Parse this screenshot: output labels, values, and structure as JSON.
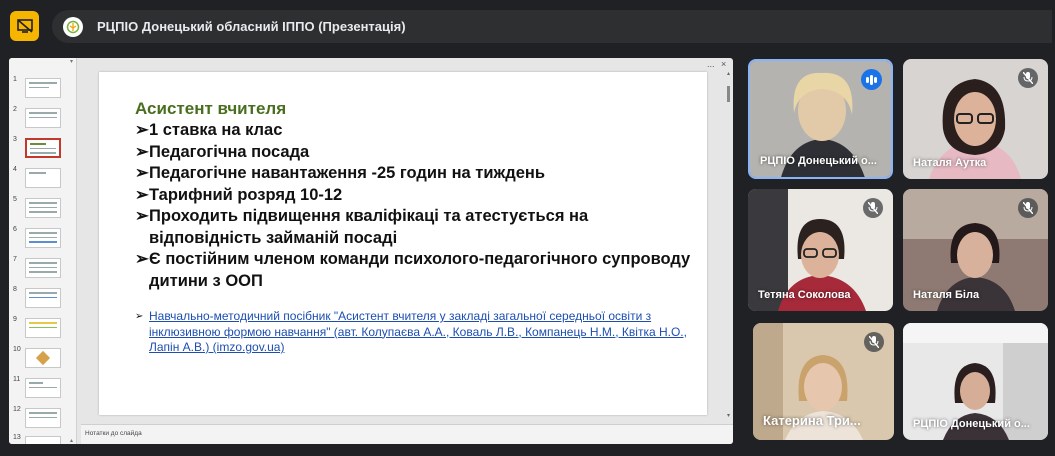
{
  "header": {
    "title": "РЦПІО Донецький обласний ІППО (Презентація)",
    "present_icon": "stop-presenting-icon",
    "accent": "#f6b500"
  },
  "ppt": {
    "thumbnails": [
      "1",
      "2",
      "3",
      "4",
      "5",
      "6",
      "7",
      "8",
      "9",
      "10",
      "11",
      "12",
      "13"
    ],
    "selected_thumbnail": "3",
    "notes_placeholder": "Нотатки до слайда",
    "window_controls": [
      "...",
      "×"
    ],
    "slide": {
      "title": "Асистент вчителя",
      "bullets": [
        "1 ставка на клас",
        "Педагогічна посада",
        "Педагогічне навантаження -25 годин на тиждень",
        "Тарифний розряд 10-12",
        "Проходить підвищення кваліфікаці та атестується на відповідність займаній посаді",
        "Є постійним членом команди психолого-педагогічного супроводу дитини з ООП"
      ],
      "link": "Навчально-методичний посібник \"Асистент вчителя у закладі загальної середньої освіти з інклюзивною формою навчання\" (авт. Колупаєва А.А., Коваль Л.В., Компанець Н.М., Квітка Н.О., Лапін А.В.) (imzo.gov.ua)",
      "title_color": "#4a6e1f",
      "link_color": "#1d4eb0"
    }
  },
  "participants": [
    {
      "name": "РЦПІО Донецький о...",
      "state": "speaking"
    },
    {
      "name": "Наталя Аутка",
      "state": "muted"
    },
    {
      "name": "Тетяна Соколова",
      "state": "muted"
    },
    {
      "name": "Наталя Біла",
      "state": "muted"
    },
    {
      "name": "Катерина Три...",
      "state": "muted"
    },
    {
      "name": "РЦПІО Донецький о...",
      "state": "none"
    }
  ]
}
